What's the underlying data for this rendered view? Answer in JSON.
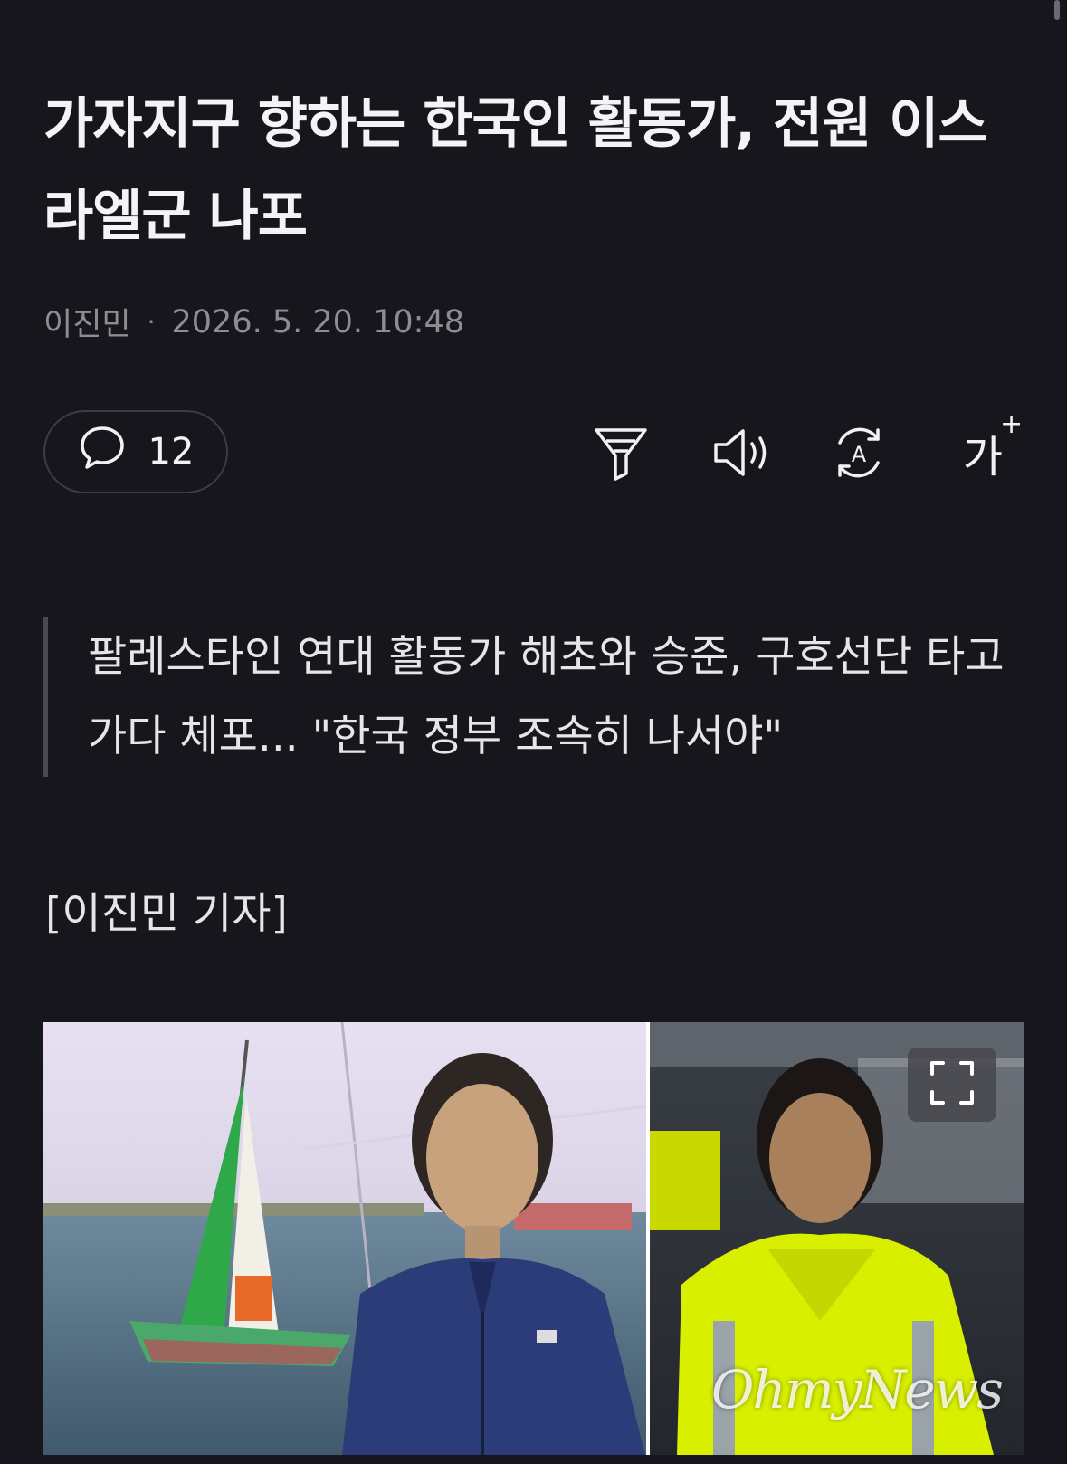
{
  "article": {
    "headline": "가자지구 향하는 한국인 활동가, 전원 이스라엘군 나포",
    "author": "이진민",
    "separator": "·",
    "datetime": "2026. 5. 20. 10:48",
    "comment_count": "12",
    "summary": "팔레스타인 연대 활동가 해초와 승준, 구호선단 타고 가다 체포... \"한국 정부 조속히 나서야\"",
    "reporter_line": "[이진민 기자]"
  },
  "toolbar": {
    "icons": [
      "comment-icon",
      "summary-filter-icon",
      "listen-speaker-icon",
      "translate-icon",
      "font-size-icon"
    ],
    "font_size_label": "가",
    "font_size_plus": "+"
  },
  "photo": {
    "watermark": "OhmyNews",
    "expand_icon": "expand-icon"
  },
  "colors": {
    "background": "#17161c",
    "text": "#f2f2f4",
    "muted": "#8e8d93",
    "border": "#3d3c44",
    "jacket_yellow": "#d8f000"
  }
}
